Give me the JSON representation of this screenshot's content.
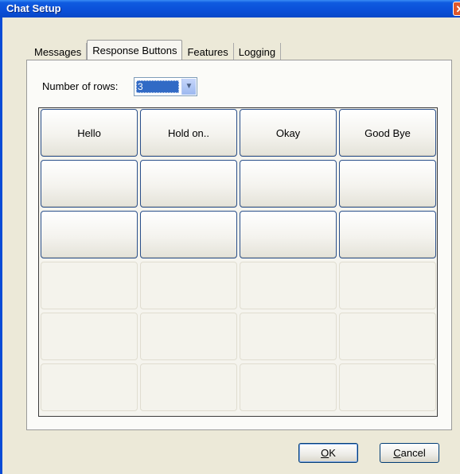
{
  "window": {
    "title": "Chat Setup",
    "close_glyph": "✕"
  },
  "tabs": [
    {
      "label": "Messages"
    },
    {
      "label": "Response Buttons",
      "active": true
    },
    {
      "label": "Features"
    },
    {
      "label": "Logging"
    }
  ],
  "rows_setting": {
    "label": "Number of rows:",
    "value": "3"
  },
  "grid": {
    "rows_total": 6,
    "columns": 4,
    "cells": [
      [
        "Hello",
        "Hold on..",
        "Okay",
        "Good Bye"
      ],
      [
        "",
        "",
        "",
        ""
      ],
      [
        "",
        "",
        "",
        ""
      ],
      [
        "",
        "",
        "",
        ""
      ],
      [
        "",
        "",
        "",
        ""
      ],
      [
        "",
        "",
        "",
        ""
      ]
    ]
  },
  "buttons": {
    "ok": {
      "mnemonic": "O",
      "rest": "K"
    },
    "cancel": {
      "mnemonic": "C",
      "rest": "ancel"
    }
  },
  "icons": {
    "dropdown": "chevron-down-icon",
    "close": "close-icon"
  }
}
